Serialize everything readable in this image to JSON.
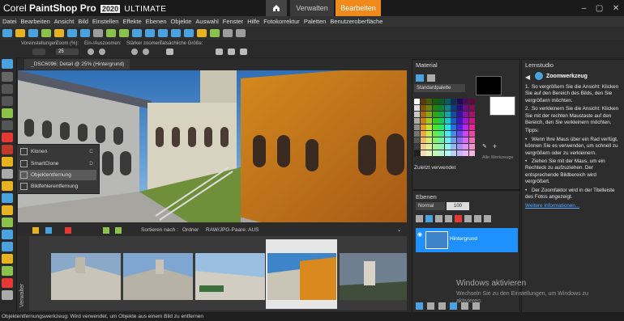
{
  "app": {
    "brand": "Corel",
    "product": "PaintShop Pro",
    "version": "2020",
    "edition": "ULTIMATE"
  },
  "workspace_tabs": {
    "manage": "Verwalten",
    "edit": "Bearbeiten",
    "active_color": "#f08a1c"
  },
  "menu": [
    "Datei",
    "Bearbeiten",
    "Ansicht",
    "Bild",
    "Einstellen",
    "Effekte",
    "Ebenen",
    "Objekte",
    "Auswahl",
    "Fenster",
    "Hilfe",
    "Fotokorrektur",
    "Paletten",
    "Benutzeroberfläche"
  ],
  "options_bar": {
    "presets": "Voreinstellungen:",
    "zoom_label": "Zoom (%):",
    "zoom_value": "25",
    "zoom_inout": "Ein-/Auszoomen:",
    "step_zoom": "Stärker zoomen:",
    "actual_size": "Tatsächliche Größe:"
  },
  "document": {
    "tab_title": "_DSC6096: Detail @  25% (Hintergrund)"
  },
  "flyout": {
    "items": [
      {
        "label": "Klonen",
        "key": "C"
      },
      {
        "label": "SmartClone",
        "key": "D"
      },
      {
        "label": "Objektentfernung",
        "key": ""
      },
      {
        "label": "Bildfehlerentfernung",
        "key": ""
      }
    ]
  },
  "organizer": {
    "sort_label": "Sortieren nach :",
    "sort_value": "Ordner",
    "raw_pairs": "RAW/JPG-Paare: AUS",
    "side_label": "Verwalter"
  },
  "material": {
    "title": "Material",
    "palette": "Standardpalette",
    "recent": "Zuletzt verwendet",
    "all_tools": "Alle Werkzeuge"
  },
  "layers": {
    "title": "Ebenen",
    "blend": "Normal",
    "opacity": "100",
    "layer_name": "Hintergrund"
  },
  "learn": {
    "title": "Lernstudio",
    "heading": "Zoomwerkzeug",
    "steps": [
      "So vergrößern Sie die Ansicht: Klicken Sie auf den Bereich des Bilds, den Sie vergrößern möchten.",
      "So verkleinern Sie die Ansicht: Klicken Sie mit der rechten Maustaste auf den Bereich, den Sie verkleinern möchten."
    ],
    "tips_label": "Tipps:",
    "tips": [
      "Wenn Ihre Maus über ein Rad verfügt, können Sie es verwenden, um schnell zu vergrößern oder zu verkleinern.",
      "Ziehen Sie mit der Maus, um ein Rechteck zu aufzuziehen. Der entsprechende Bildbereich wird vergrößert.",
      "Der Zoomfaktor wird in der Titelleiste des Fotos angezeigt."
    ],
    "more": "Weitere Informationen..."
  },
  "windows_activation": {
    "title": "Windows aktivieren",
    "text": "Wechseln Sie zu den Einstellungen, um Windows zu aktivieren."
  },
  "status": "Objektentfernungswerkzeug: Wird verwendet, um Objekte aus einem Bild zu entfernen",
  "icons": [
    "home-icon",
    "minimize-icon",
    "maximize-icon",
    "close-icon",
    "zoom-tool-icon",
    "undo-icon",
    "redo-icon"
  ]
}
